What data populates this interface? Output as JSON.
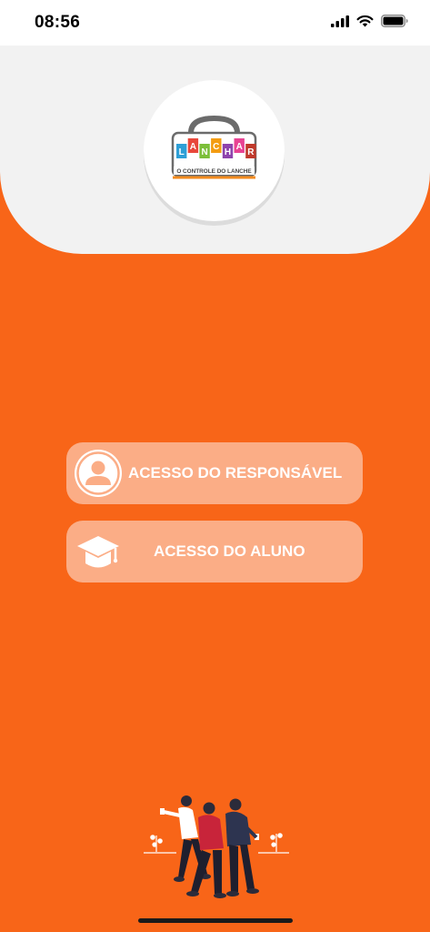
{
  "status_bar": {
    "time": "08:56",
    "icons": [
      "signal-icon",
      "wifi-icon",
      "battery-icon"
    ]
  },
  "logo": {
    "letters": [
      "L",
      "A",
      "N",
      "C",
      "H",
      "A",
      "R"
    ],
    "letter_colors": [
      "#2e9fd6",
      "#e8483b",
      "#7cbf3a",
      "#f39c12",
      "#8e44ad",
      "#e84393",
      "#c0392b"
    ],
    "tagline": "O CONTROLE DO LANCHE"
  },
  "buttons": {
    "responsavel": {
      "label": "ACESSO DO RESPONSÁVEL",
      "icon": "user-avatar-icon"
    },
    "aluno": {
      "label": "ACESSO DO ALUNO",
      "icon": "graduation-cap-icon"
    }
  },
  "colors": {
    "background": "#f86518",
    "button": "#fbad86",
    "header": "#f2f2f2"
  }
}
